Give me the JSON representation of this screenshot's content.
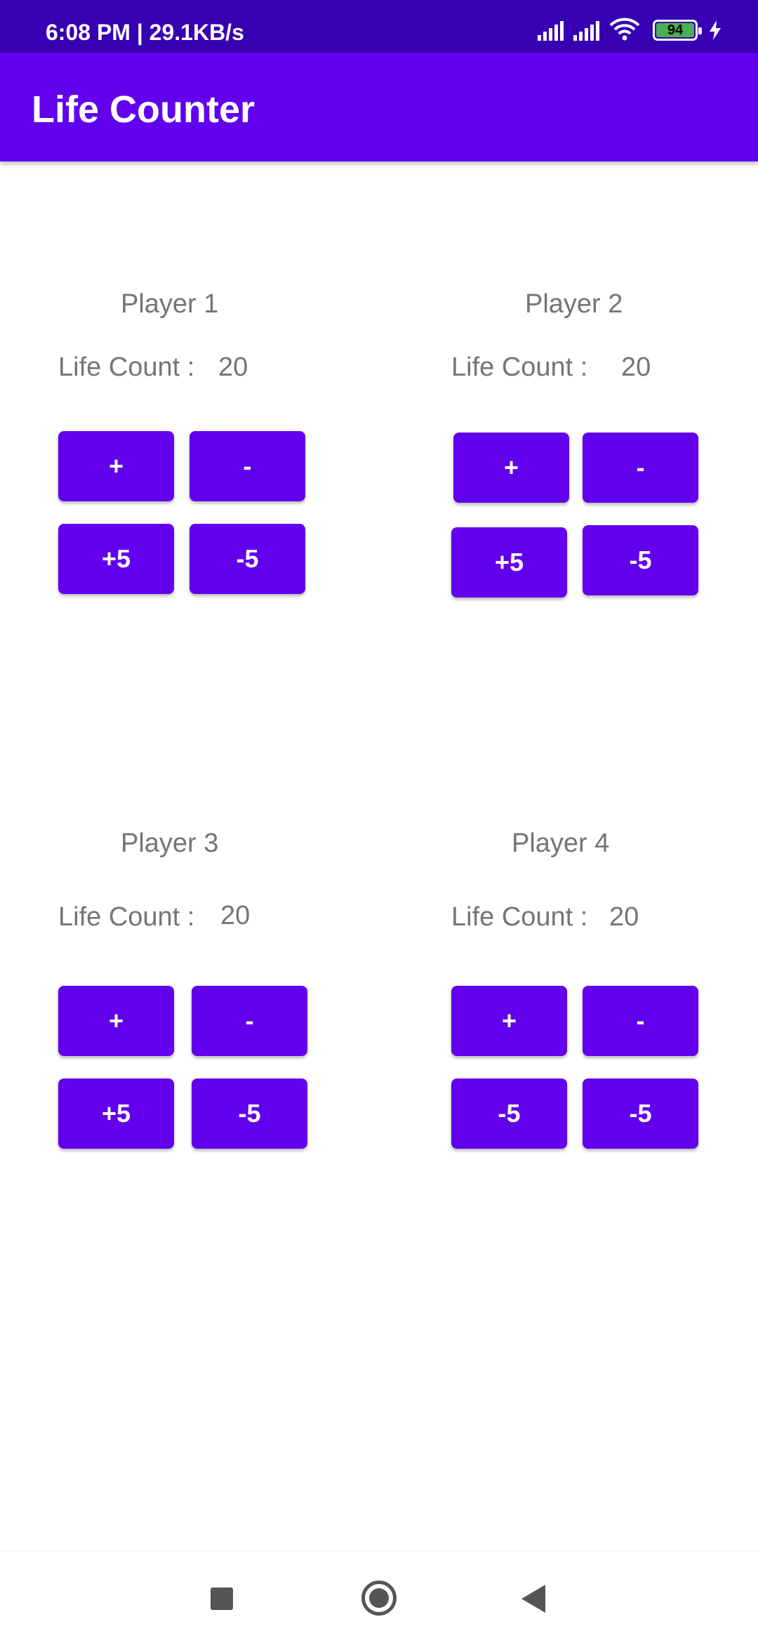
{
  "status_bar": {
    "time_speed": "6:08 PM | 29.1KB/s",
    "battery_level": "94",
    "icons": [
      "signal-icon",
      "signal-icon",
      "wifi-icon",
      "battery-icon",
      "charging-icon"
    ]
  },
  "app_bar": {
    "title": "Life Counter",
    "color": "#6200ee"
  },
  "players": [
    {
      "title": "Player 1",
      "life_label": "Life Count :",
      "life_value": "20",
      "buttons": [
        "+",
        "-",
        "+5",
        "-5"
      ]
    },
    {
      "title": "Player 2",
      "life_label": "Life Count :",
      "life_value": "20",
      "buttons": [
        "+",
        "-",
        "+5",
        "-5"
      ]
    },
    {
      "title": "Player 3",
      "life_label": "Life Count :",
      "life_value": "20",
      "buttons": [
        "+",
        "-",
        "+5",
        "-5"
      ]
    },
    {
      "title": "Player 4",
      "life_label": "Life Count :",
      "life_value": "20",
      "buttons": [
        "+",
        "-",
        "-5",
        "-5"
      ]
    }
  ],
  "nav_bar": {
    "icons": [
      "recent-apps-icon",
      "home-icon",
      "back-icon"
    ]
  }
}
